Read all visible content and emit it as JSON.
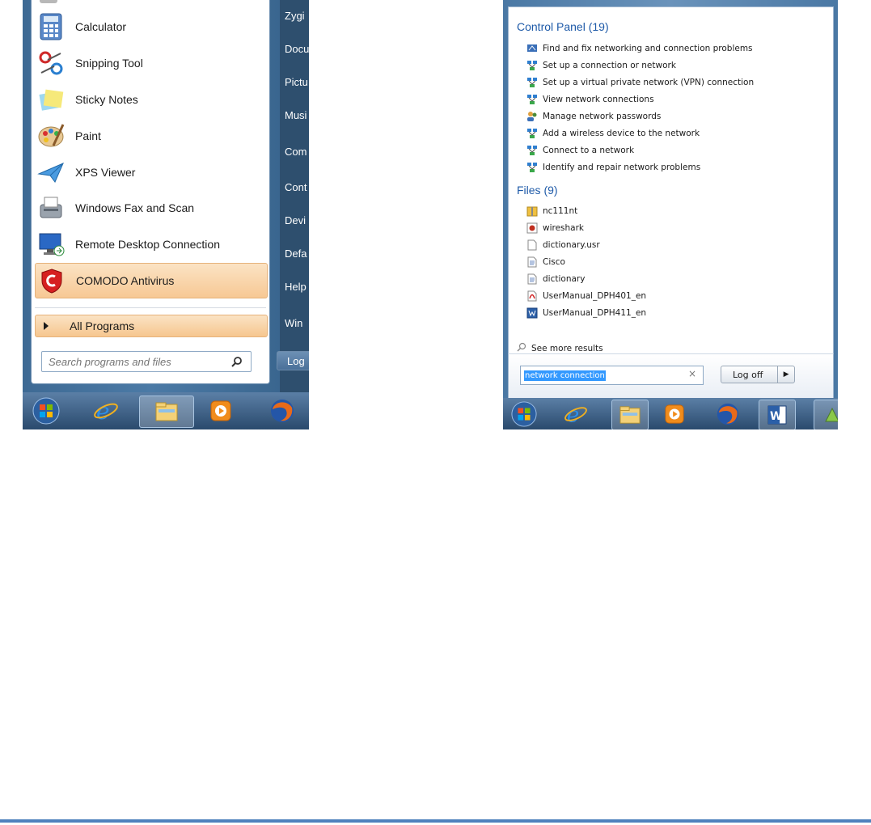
{
  "left_menu": {
    "programs": [
      {
        "label": "Calculator",
        "icon": "calculator-icon"
      },
      {
        "label": "Snipping Tool",
        "icon": "scissors-icon"
      },
      {
        "label": "Sticky Notes",
        "icon": "sticky-notes-icon"
      },
      {
        "label": "Paint",
        "icon": "paint-palette-icon"
      },
      {
        "label": "XPS Viewer",
        "icon": "paper-plane-icon"
      },
      {
        "label": "Windows Fax and Scan",
        "icon": "fax-icon"
      },
      {
        "label": "Remote Desktop Connection",
        "icon": "monitor-icon"
      },
      {
        "label": "COMODO Antivirus",
        "icon": "shield-icon"
      }
    ],
    "all_programs_label": "All Programs",
    "search_placeholder": "Search programs and files",
    "right_column": [
      "Zygi",
      "Docu",
      "Pictu",
      "Musi",
      "Com",
      "Cont",
      "Devi",
      "Defa",
      "Help",
      "Win"
    ],
    "logoff_label": "Log"
  },
  "right_menu": {
    "control_panel_header": "Control Panel (19)",
    "control_panel_items": [
      "Find and fix networking and connection problems",
      "Set up a connection or network",
      "Set up a virtual private network (VPN) connection",
      "View network connections",
      "Manage network passwords",
      "Add a wireless device to the network",
      "Connect to a network",
      "Identify and repair network problems"
    ],
    "files_header": "Files (9)",
    "file_items": [
      "nc111nt",
      "wireshark",
      "dictionary.usr",
      "Cisco",
      "dictionary",
      "UserManual_DPH401_en",
      "UserManual_DPH411_en"
    ],
    "see_more": "See more results",
    "search_value": "network connection",
    "clear_glyph": "×",
    "logoff_label": "Log off",
    "logoff_arrow": "▶"
  },
  "colors": {
    "accent": "#4f81bd",
    "highlight": "#f7c894",
    "link": "#1e5aa8"
  }
}
